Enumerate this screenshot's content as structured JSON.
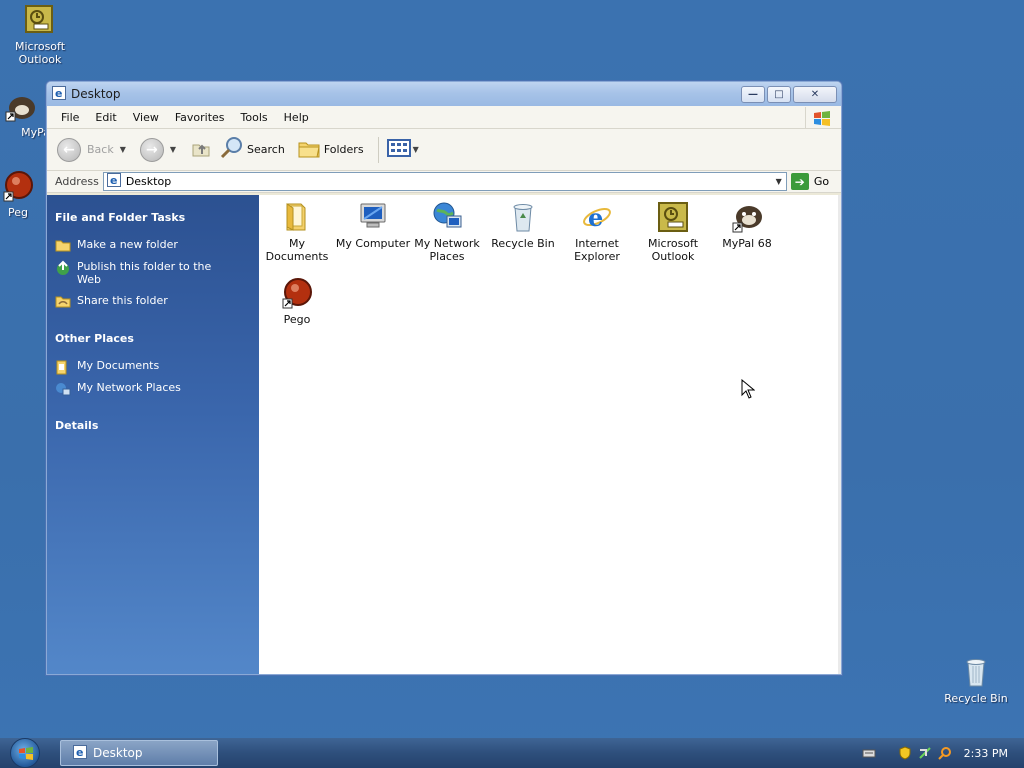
{
  "desktop": {
    "icons": [
      {
        "label_1": "Microsoft",
        "label_2": "Outlook"
      },
      {
        "label_1": "MyPa",
        "label_2": ""
      },
      {
        "label_1": "Peg",
        "label_2": ""
      },
      {
        "label_1": "Recycle Bin",
        "label_2": ""
      }
    ]
  },
  "window": {
    "title": "Desktop",
    "menu": [
      "File",
      "Edit",
      "View",
      "Favorites",
      "Tools",
      "Help"
    ],
    "toolbar": {
      "back": "Back",
      "search": "Search",
      "folders": "Folders"
    },
    "address": {
      "label": "Address",
      "value": "Desktop",
      "go": "Go"
    },
    "taskpane": {
      "file_tasks_title": "File and Folder Tasks",
      "file_tasks": [
        "Make a new folder",
        "Publish this folder to the Web",
        "Share this folder"
      ],
      "other_places_title": "Other Places",
      "other_places": [
        "My Documents",
        "My Network Places"
      ],
      "details_title": "Details"
    },
    "items": [
      {
        "line1": "My",
        "line2": "Documents",
        "icon": "folder-icon"
      },
      {
        "line1": "My Computer",
        "line2": "",
        "icon": "computer-icon"
      },
      {
        "line1": "My Network",
        "line2": "Places",
        "icon": "network-icon"
      },
      {
        "line1": "Recycle Bin",
        "line2": "",
        "icon": "recycle-bin-icon"
      },
      {
        "line1": "Internet",
        "line2": "Explorer",
        "icon": "ie-icon"
      },
      {
        "line1": "Microsoft",
        "line2": "Outlook",
        "icon": "outlook-icon"
      },
      {
        "line1": "MyPal 68",
        "line2": "",
        "icon": "mypal-icon"
      },
      {
        "line1": "Pego",
        "line2": "",
        "icon": "pego-icon"
      }
    ]
  },
  "taskbar": {
    "task_label": "Desktop",
    "clock": "2:33 PM"
  }
}
